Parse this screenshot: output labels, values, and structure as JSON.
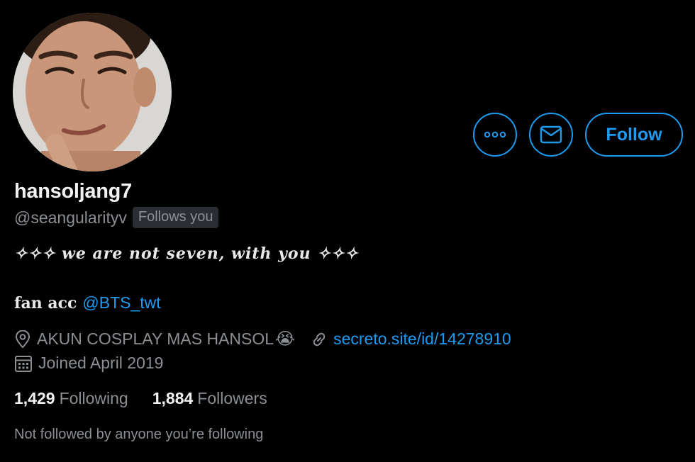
{
  "profile": {
    "display_name": "hansoljang7",
    "handle": "@seangularityv",
    "follows_you_badge": "Follows you",
    "bio_line1": "✧✧✧ we are not seven, with you ✧✧✧",
    "bio_line2_prefix": "fan acc",
    "bio_mention": "@BTS_twt",
    "location": "AKUN COSPLAY MAS HANSOL",
    "location_emoji": "😭",
    "website": "secreto.site/id/14278910",
    "joined": "Joined April 2019",
    "not_followed_text": "Not followed by anyone you’re following"
  },
  "stats": {
    "following_count": "1,429",
    "following_label": "Following",
    "followers_count": "1,884",
    "followers_label": "Followers"
  },
  "actions": {
    "more_icon": "more-icon",
    "message_icon": "mail-icon",
    "follow_label": "Follow"
  },
  "colors": {
    "background": "#000000",
    "accent": "#1d9bf0",
    "primary_text": "#e7e9ea",
    "secondary_text": "#8b8f94",
    "badge_bg": "#2a2d31"
  }
}
